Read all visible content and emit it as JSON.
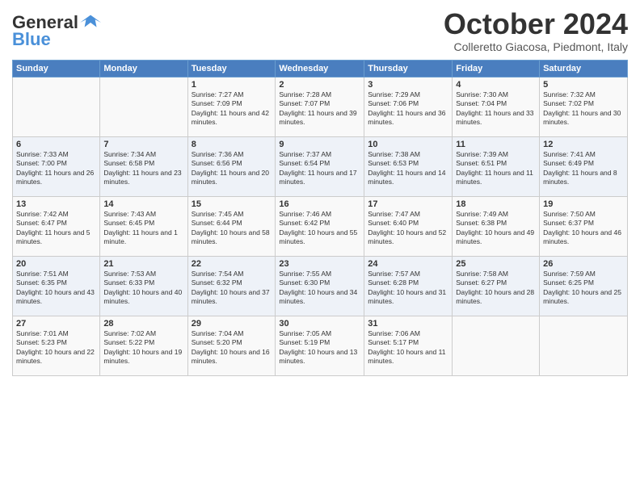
{
  "header": {
    "logo_text_general": "General",
    "logo_text_blue": "Blue",
    "month_title": "October 2024",
    "location": "Colleretto Giacosa, Piedmont, Italy"
  },
  "days_of_week": [
    "Sunday",
    "Monday",
    "Tuesday",
    "Wednesday",
    "Thursday",
    "Friday",
    "Saturday"
  ],
  "weeks": [
    [
      {
        "day": "",
        "info": ""
      },
      {
        "day": "",
        "info": ""
      },
      {
        "day": "1",
        "info": "Sunrise: 7:27 AM\nSunset: 7:09 PM\nDaylight: 11 hours and 42 minutes."
      },
      {
        "day": "2",
        "info": "Sunrise: 7:28 AM\nSunset: 7:07 PM\nDaylight: 11 hours and 39 minutes."
      },
      {
        "day": "3",
        "info": "Sunrise: 7:29 AM\nSunset: 7:06 PM\nDaylight: 11 hours and 36 minutes."
      },
      {
        "day": "4",
        "info": "Sunrise: 7:30 AM\nSunset: 7:04 PM\nDaylight: 11 hours and 33 minutes."
      },
      {
        "day": "5",
        "info": "Sunrise: 7:32 AM\nSunset: 7:02 PM\nDaylight: 11 hours and 30 minutes."
      }
    ],
    [
      {
        "day": "6",
        "info": "Sunrise: 7:33 AM\nSunset: 7:00 PM\nDaylight: 11 hours and 26 minutes."
      },
      {
        "day": "7",
        "info": "Sunrise: 7:34 AM\nSunset: 6:58 PM\nDaylight: 11 hours and 23 minutes."
      },
      {
        "day": "8",
        "info": "Sunrise: 7:36 AM\nSunset: 6:56 PM\nDaylight: 11 hours and 20 minutes."
      },
      {
        "day": "9",
        "info": "Sunrise: 7:37 AM\nSunset: 6:54 PM\nDaylight: 11 hours and 17 minutes."
      },
      {
        "day": "10",
        "info": "Sunrise: 7:38 AM\nSunset: 6:53 PM\nDaylight: 11 hours and 14 minutes."
      },
      {
        "day": "11",
        "info": "Sunrise: 7:39 AM\nSunset: 6:51 PM\nDaylight: 11 hours and 11 minutes."
      },
      {
        "day": "12",
        "info": "Sunrise: 7:41 AM\nSunset: 6:49 PM\nDaylight: 11 hours and 8 minutes."
      }
    ],
    [
      {
        "day": "13",
        "info": "Sunrise: 7:42 AM\nSunset: 6:47 PM\nDaylight: 11 hours and 5 minutes."
      },
      {
        "day": "14",
        "info": "Sunrise: 7:43 AM\nSunset: 6:45 PM\nDaylight: 11 hours and 1 minute."
      },
      {
        "day": "15",
        "info": "Sunrise: 7:45 AM\nSunset: 6:44 PM\nDaylight: 10 hours and 58 minutes."
      },
      {
        "day": "16",
        "info": "Sunrise: 7:46 AM\nSunset: 6:42 PM\nDaylight: 10 hours and 55 minutes."
      },
      {
        "day": "17",
        "info": "Sunrise: 7:47 AM\nSunset: 6:40 PM\nDaylight: 10 hours and 52 minutes."
      },
      {
        "day": "18",
        "info": "Sunrise: 7:49 AM\nSunset: 6:38 PM\nDaylight: 10 hours and 49 minutes."
      },
      {
        "day": "19",
        "info": "Sunrise: 7:50 AM\nSunset: 6:37 PM\nDaylight: 10 hours and 46 minutes."
      }
    ],
    [
      {
        "day": "20",
        "info": "Sunrise: 7:51 AM\nSunset: 6:35 PM\nDaylight: 10 hours and 43 minutes."
      },
      {
        "day": "21",
        "info": "Sunrise: 7:53 AM\nSunset: 6:33 PM\nDaylight: 10 hours and 40 minutes."
      },
      {
        "day": "22",
        "info": "Sunrise: 7:54 AM\nSunset: 6:32 PM\nDaylight: 10 hours and 37 minutes."
      },
      {
        "day": "23",
        "info": "Sunrise: 7:55 AM\nSunset: 6:30 PM\nDaylight: 10 hours and 34 minutes."
      },
      {
        "day": "24",
        "info": "Sunrise: 7:57 AM\nSunset: 6:28 PM\nDaylight: 10 hours and 31 minutes."
      },
      {
        "day": "25",
        "info": "Sunrise: 7:58 AM\nSunset: 6:27 PM\nDaylight: 10 hours and 28 minutes."
      },
      {
        "day": "26",
        "info": "Sunrise: 7:59 AM\nSunset: 6:25 PM\nDaylight: 10 hours and 25 minutes."
      }
    ],
    [
      {
        "day": "27",
        "info": "Sunrise: 7:01 AM\nSunset: 5:23 PM\nDaylight: 10 hours and 22 minutes."
      },
      {
        "day": "28",
        "info": "Sunrise: 7:02 AM\nSunset: 5:22 PM\nDaylight: 10 hours and 19 minutes."
      },
      {
        "day": "29",
        "info": "Sunrise: 7:04 AM\nSunset: 5:20 PM\nDaylight: 10 hours and 16 minutes."
      },
      {
        "day": "30",
        "info": "Sunrise: 7:05 AM\nSunset: 5:19 PM\nDaylight: 10 hours and 13 minutes."
      },
      {
        "day": "31",
        "info": "Sunrise: 7:06 AM\nSunset: 5:17 PM\nDaylight: 10 hours and 11 minutes."
      },
      {
        "day": "",
        "info": ""
      },
      {
        "day": "",
        "info": ""
      }
    ]
  ]
}
